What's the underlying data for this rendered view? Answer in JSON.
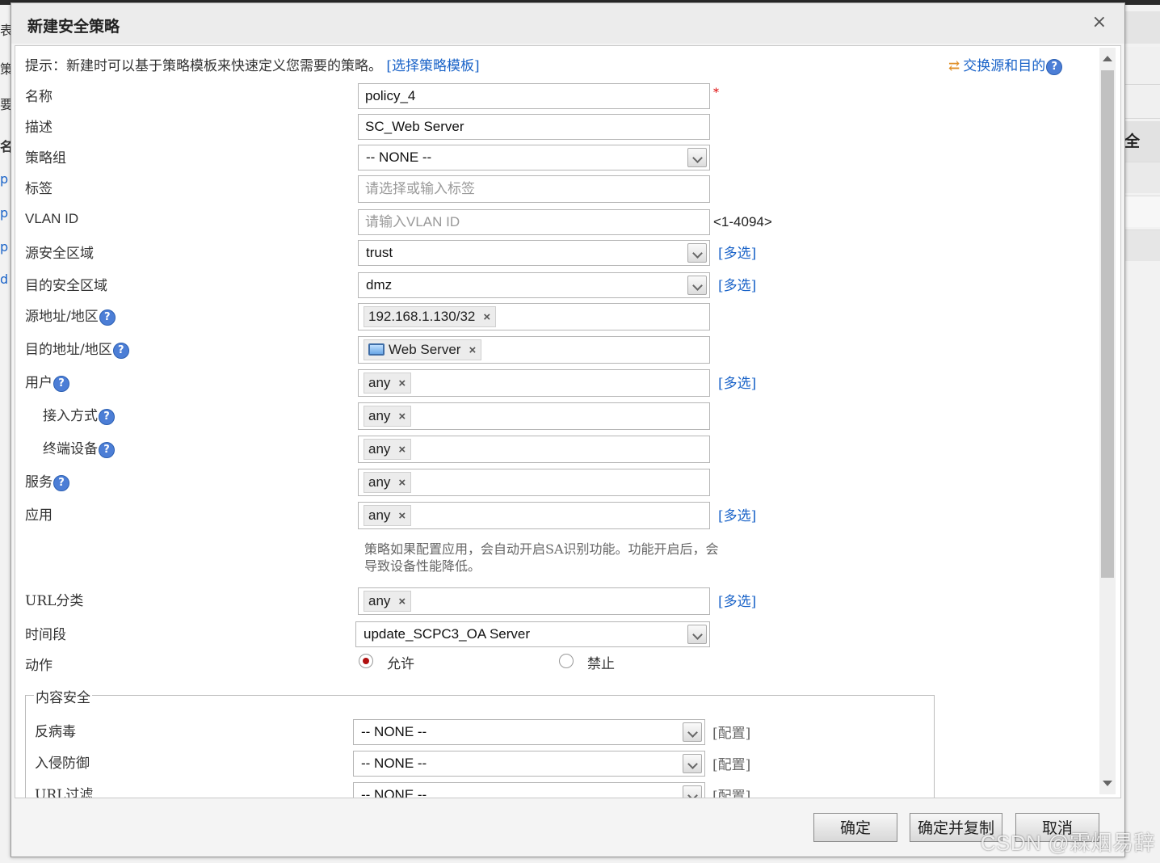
{
  "background": {
    "left_chars": [
      "表",
      "策",
      "要",
      "名",
      "p",
      "p",
      "p",
      "d"
    ],
    "right_header": "全"
  },
  "dialog": {
    "title": "新建安全策略",
    "close_symbol": "×"
  },
  "tip": {
    "text": "提示：新建时可以基于策略模板来快速定义您需要的策略。",
    "template_link": "[选择策略模板]",
    "swap_link": "交换源和目的",
    "swap_icon": "⇄"
  },
  "help_symbol": "?",
  "remove_symbol": "×",
  "form": {
    "name": {
      "label": "名称",
      "value": "policy_4",
      "required": "*"
    },
    "description": {
      "label": "描述",
      "value": "SC_Web Server"
    },
    "policy_group": {
      "label": "策略组",
      "value": "-- NONE --"
    },
    "tags": {
      "label": "标签",
      "placeholder": "请选择或输入标签"
    },
    "vlan_id": {
      "label": "VLAN ID",
      "placeholder": "请输入VLAN ID",
      "range": "<1-4094>"
    },
    "source_zone": {
      "label": "源安全区域",
      "value": "trust",
      "multi": "[多选]"
    },
    "dest_zone": {
      "label": "目的安全区域",
      "value": "dmz",
      "multi": "[多选]"
    },
    "source_address": {
      "label": "源地址/地区",
      "tag": "192.168.1.130/32"
    },
    "dest_address": {
      "label": "目的地址/地区",
      "tag": "Web Server",
      "tag_icon": "monitor-icon"
    },
    "user": {
      "label": "用户",
      "tag": "any",
      "multi": "[多选]"
    },
    "access_method": {
      "label": "接入方式",
      "tag": "any"
    },
    "terminal_device": {
      "label": "终端设备",
      "tag": "any"
    },
    "service": {
      "label": "服务",
      "tag": "any"
    },
    "application": {
      "label": "应用",
      "tag": "any",
      "multi": "[多选]",
      "note": "策略如果配置应用，会自动开启SA识别功能。功能开启后，会导致设备性能降低。"
    },
    "url_category": {
      "label": "URL分类",
      "tag": "any",
      "multi": "[多选]"
    },
    "time_range": {
      "label": "时间段",
      "value": "update_SCPC3_OA Server"
    },
    "action": {
      "label": "动作",
      "allow": "允许",
      "deny": "禁止",
      "selected": "允许"
    }
  },
  "content_security": {
    "legend": "内容安全",
    "antivirus": {
      "label": "反病毒",
      "value": "-- NONE --",
      "config": "[配置]"
    },
    "intrusion": {
      "label": "入侵防御",
      "value": "-- NONE --",
      "config": "[配置]"
    },
    "url_filter": {
      "label": "URL过滤",
      "value": "-- NONE --",
      "config": "[配置]"
    }
  },
  "buttons": {
    "ok": "确定",
    "ok_copy": "确定并复制",
    "cancel": "取消"
  },
  "watermark": "CSDN @霖烟易辞"
}
